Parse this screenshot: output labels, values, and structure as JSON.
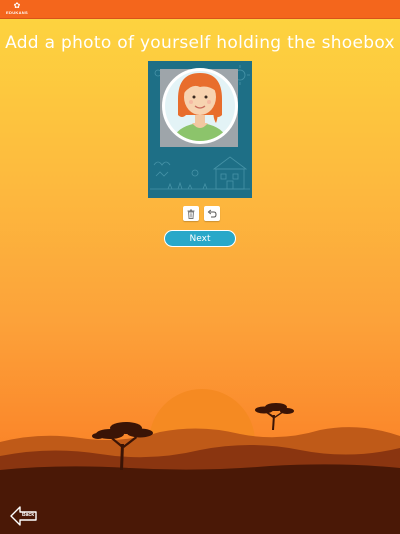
{
  "header": {
    "logo_text": "EDUKANS",
    "logo_icon": "paw-icon"
  },
  "main": {
    "title": "Add a photo of yourself holding the shoebox",
    "avatar_icon": "girl-avatar-placeholder",
    "delete_icon": "trash-icon",
    "undo_icon": "undo-icon",
    "next_label": "Next"
  },
  "footer": {
    "back_label": "Back"
  },
  "colors": {
    "topbar": "#f4661c",
    "next_button": "#29a8c9",
    "photo_frame": "#1e6f86",
    "ground": "#4a1806"
  }
}
